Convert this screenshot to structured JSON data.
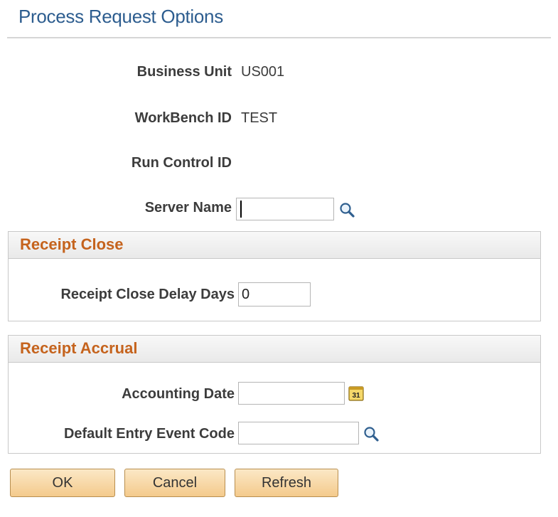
{
  "page": {
    "title": "Process Request Options"
  },
  "fields": {
    "business_unit": {
      "label": "Business Unit",
      "value": "US001"
    },
    "workbench_id": {
      "label": "WorkBench ID",
      "value": "TEST"
    },
    "run_control_id": {
      "label": "Run Control ID",
      "value": ""
    },
    "server_name": {
      "label": "Server Name",
      "value": "",
      "focused": true
    }
  },
  "receipt_close": {
    "title": "Receipt Close",
    "delay_days": {
      "label": "Receipt Close Delay Days",
      "value": "0"
    }
  },
  "receipt_accrual": {
    "title": "Receipt Accrual",
    "accounting_date": {
      "label": "Accounting Date",
      "value": "",
      "icon": "calendar-icon",
      "icon_text": "31"
    },
    "entry_event_code": {
      "label": "Default Entry Event Code",
      "value": "",
      "icon": "lookup-icon"
    }
  },
  "buttons": {
    "ok": "OK",
    "cancel": "Cancel",
    "refresh": "Refresh"
  },
  "colors": {
    "title": "#2d5d8f",
    "group_title": "#c5631d",
    "button_top": "#fbe8c6",
    "button_bottom": "#f4ca8c"
  }
}
